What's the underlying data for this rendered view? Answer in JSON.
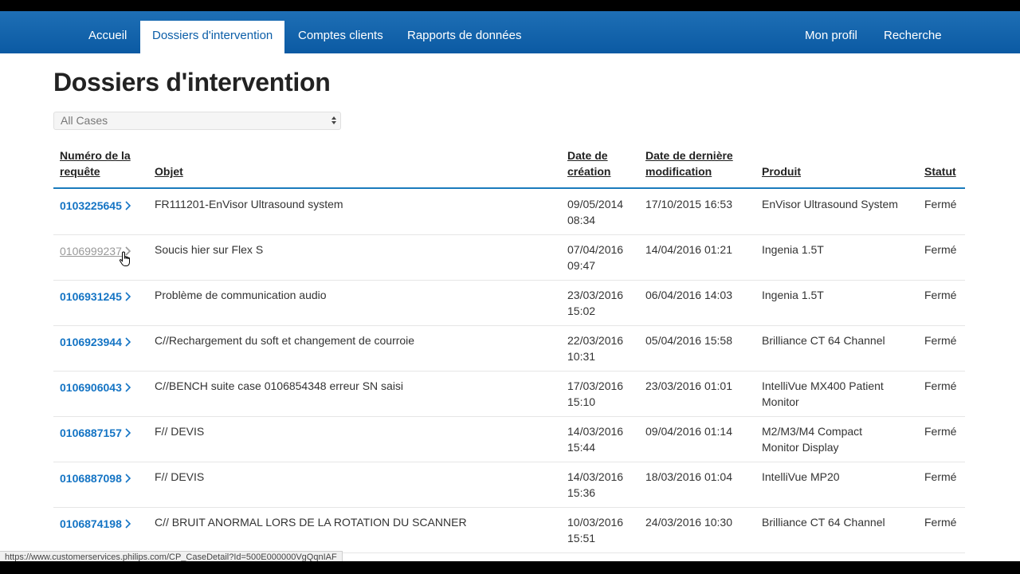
{
  "nav": {
    "left": [
      {
        "label": "Accueil",
        "active": false
      },
      {
        "label": "Dossiers d'intervention",
        "active": true
      },
      {
        "label": "Comptes clients",
        "active": false
      },
      {
        "label": "Rapports de données",
        "active": false
      }
    ],
    "right": [
      {
        "label": "Mon profil"
      },
      {
        "label": "Recherche"
      }
    ]
  },
  "page": {
    "title": "Dossiers d'intervention",
    "filter_value": "All Cases"
  },
  "table": {
    "headers": {
      "case_number": [
        "Numéro de la",
        "requête"
      ],
      "subject": "Objet",
      "created": [
        "Date de",
        "création"
      ],
      "modified": [
        "Date de dernière",
        "modification"
      ],
      "product": "Produit",
      "status": "Statut"
    },
    "rows": [
      {
        "case": "0103225645",
        "subject": "FR111201-EnVisor Ultrasound system",
        "created": [
          "09/05/2014",
          "08:34"
        ],
        "modified": "17/10/2015 16:53",
        "product": [
          "EnVisor Ultrasound System"
        ],
        "status": "Fermé",
        "visited": false
      },
      {
        "case": "0106999237",
        "subject": "Soucis hier sur Flex S",
        "created": [
          "07/04/2016",
          "09:47"
        ],
        "modified": "14/04/2016 01:21",
        "product": [
          "Ingenia 1.5T"
        ],
        "status": "Fermé",
        "visited": true
      },
      {
        "case": "0106931245",
        "subject": "Problème de communication audio",
        "created": [
          "23/03/2016",
          "15:02"
        ],
        "modified": "06/04/2016 14:03",
        "product": [
          "Ingenia 1.5T"
        ],
        "status": "Fermé",
        "visited": false
      },
      {
        "case": "0106923944",
        "subject": "C//Rechargement du soft et changement de courroie",
        "created": [
          "22/03/2016",
          "10:31"
        ],
        "modified": "05/04/2016 15:58",
        "product": [
          "Brilliance CT 64 Channel"
        ],
        "status": "Fermé",
        "visited": false
      },
      {
        "case": "0106906043",
        "subject": "C//BENCH suite case 0106854348 erreur SN saisi",
        "created": [
          "17/03/2016",
          "15:10"
        ],
        "modified": "23/03/2016 01:01",
        "product": [
          "IntelliVue MX400 Patient",
          "Monitor"
        ],
        "status": "Fermé",
        "visited": false
      },
      {
        "case": "0106887157",
        "subject": "F// DEVIS",
        "created": [
          "14/03/2016",
          "15:44"
        ],
        "modified": "09/04/2016 01:14",
        "product": [
          "M2/M3/M4 Compact",
          "Monitor Display"
        ],
        "status": "Fermé",
        "visited": false
      },
      {
        "case": "0106887098",
        "subject": "F// DEVIS",
        "created": [
          "14/03/2016",
          "15:36"
        ],
        "modified": "18/03/2016 01:04",
        "product": [
          "IntelliVue MP20"
        ],
        "status": "Fermé",
        "visited": false
      },
      {
        "case": "0106874198",
        "subject": "C// BRUIT ANORMAL LORS DE LA ROTATION DU SCANNER",
        "created": [
          "10/03/2016",
          "15:51"
        ],
        "modified": "24/03/2016 10:30",
        "product": [
          "Brilliance CT 64 Channel"
        ],
        "status": "Fermé",
        "visited": false
      }
    ]
  },
  "status_bar": {
    "url": "https://www.customerservices.philips.com/CP_CaseDetail?Id=500E000000VgQqnIAF"
  },
  "colors": {
    "nav_bg": "#0b5aa3",
    "link": "#1474c4",
    "visited_link": "#999999",
    "header_rule": "#1a7bbd"
  },
  "icons": {
    "row_link": "chevron-right-icon",
    "select": "select-arrows-icon",
    "pointer": "hand-cursor-icon"
  }
}
